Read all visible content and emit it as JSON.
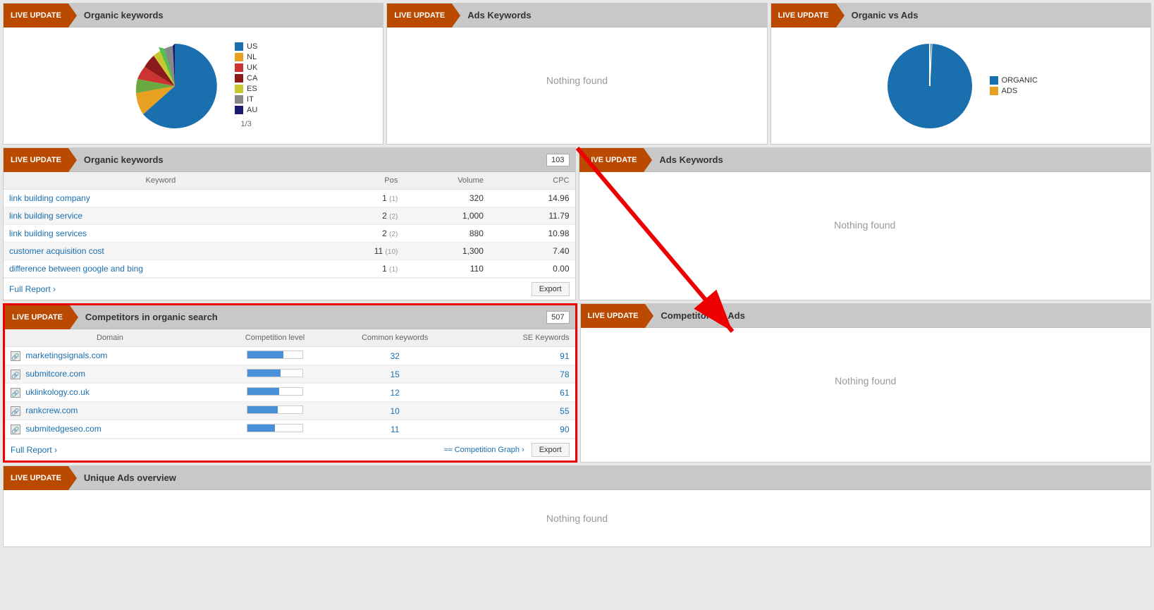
{
  "liveUpdate": "LIVE UPDATE",
  "topRow": {
    "panel1": {
      "title": "Organic keywords",
      "legend": [
        {
          "color": "#1a6faf",
          "label": "US"
        },
        {
          "color": "#e8a020",
          "label": "NL"
        },
        {
          "color": "#cc3333",
          "label": "UK"
        },
        {
          "color": "#8b1a1a",
          "label": "CA"
        },
        {
          "color": "#c8c830",
          "label": "ES"
        },
        {
          "color": "#666",
          "label": "IT"
        },
        {
          "color": "#1a1a6f",
          "label": "AU"
        }
      ],
      "pagination": "1/3"
    },
    "panel2": {
      "title": "Ads Keywords",
      "nothingFound": "Nothing found"
    },
    "panel3": {
      "title": "Organic vs Ads",
      "legend": [
        {
          "color": "#1a6faf",
          "label": "ORGANIC"
        },
        {
          "color": "#e8a020",
          "label": "ADS"
        }
      ]
    }
  },
  "organicKeywords": {
    "title": "Organic keywords",
    "badge": "103",
    "columns": [
      "Keyword",
      "Pos",
      "Volume",
      "CPC"
    ],
    "rows": [
      {
        "keyword": "link building company",
        "pos": "1",
        "posSub": "(1)",
        "volume": "320",
        "cpc": "14.96"
      },
      {
        "keyword": "link building service",
        "pos": "2",
        "posSub": "(2)",
        "volume": "1,000",
        "cpc": "11.79"
      },
      {
        "keyword": "link building services",
        "pos": "2",
        "posSub": "(2)",
        "volume": "880",
        "cpc": "10.98"
      },
      {
        "keyword": "customer acquisition cost",
        "pos": "11",
        "posSub": "(10)",
        "volume": "1,300",
        "cpc": "7.40"
      },
      {
        "keyword": "difference between google and bing",
        "pos": "1",
        "posSub": "(1)",
        "volume": "110",
        "cpc": "0.00"
      }
    ],
    "fullReport": "Full Report ›",
    "exportLabel": "Export"
  },
  "adsKeywords": {
    "title": "Ads Keywords",
    "nothingFound": "Nothing found"
  },
  "competitorsOrganic": {
    "title": "Competitors in organic search",
    "badge": "507",
    "columns": [
      "Domain",
      "Competition level",
      "Common keywords",
      "SE Keywords"
    ],
    "rows": [
      {
        "domain": "marketingsignals.com",
        "competition": 65,
        "common": "32",
        "se": "91"
      },
      {
        "domain": "submitcore.com",
        "competition": 60,
        "common": "15",
        "se": "78"
      },
      {
        "domain": "uklinkology.co.uk",
        "competition": 58,
        "common": "12",
        "se": "61"
      },
      {
        "domain": "rankcrew.com",
        "competition": 55,
        "common": "10",
        "se": "55"
      },
      {
        "domain": "submitedgeseo.com",
        "competition": 50,
        "common": "11",
        "se": "90"
      }
    ],
    "fullReport": "Full Report ›",
    "competitionGraph": "Competition Graph ›",
    "exportLabel": "Export"
  },
  "competitorsAds": {
    "title": "Competitors in Ads",
    "nothingFound": "Nothing found"
  },
  "uniqueAds": {
    "title": "Unique Ads overview",
    "nothingFound": "Nothing found"
  }
}
